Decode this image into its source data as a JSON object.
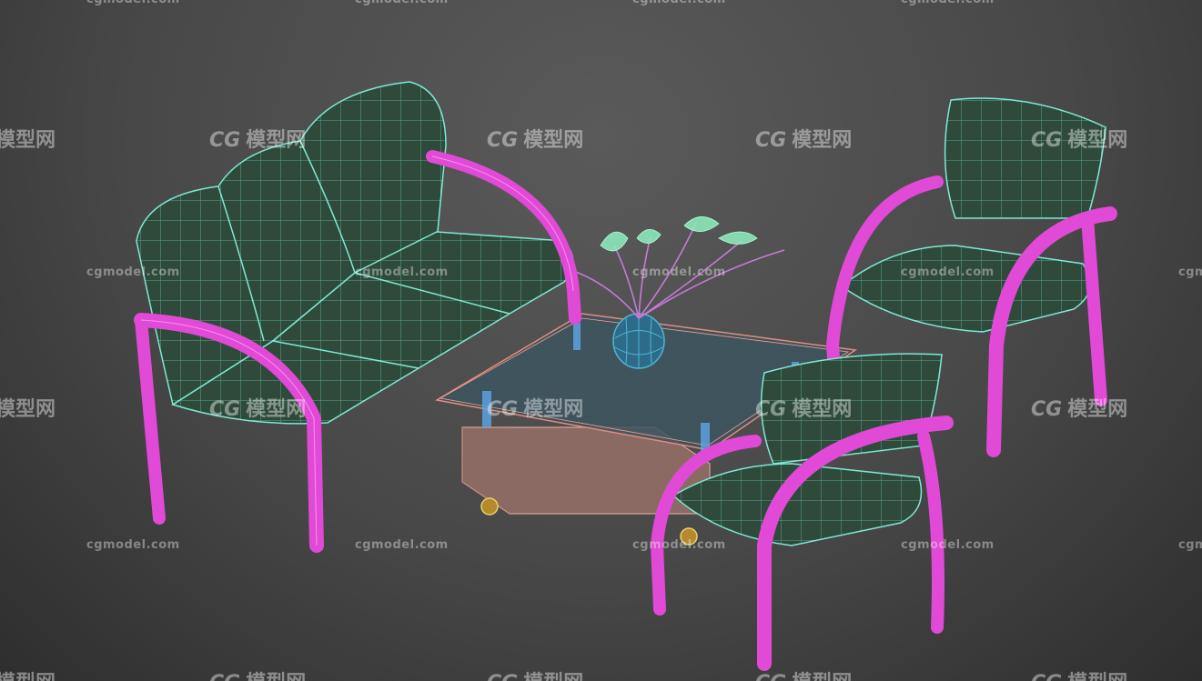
{
  "watermark": {
    "site": "cgmodel.com",
    "logo_mark": "CG",
    "logo_text": "模型网"
  },
  "colors": {
    "frame": "#e04ad6",
    "cushion_wire": "#7fe8d6",
    "cushion_fill": "#2f4a3a",
    "glass": "#3d5560",
    "table_body": "#8a6a62",
    "vase": "#4fb6d8",
    "leaves": "#8ef0c0"
  }
}
